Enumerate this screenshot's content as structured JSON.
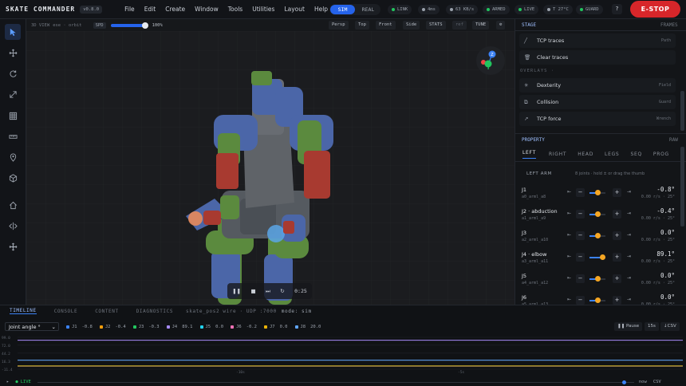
{
  "topbar": {
    "brand": "SKATE COMMANDER",
    "version": "v0.8.0",
    "menu": [
      "File",
      "Edit",
      "Create",
      "Window",
      "Tools",
      "Utilities",
      "Layout",
      "Help"
    ],
    "mode_sim": "SIM",
    "mode_real": "REAL",
    "link": "LINK",
    "latency": "4ms",
    "bandwidth": "63 KB/s",
    "armed": "ARMED",
    "live": "LIVE",
    "temp": "T 27°C",
    "guard": "GUARD",
    "help": "?",
    "estop": "E-STOP"
  },
  "viewport": {
    "view_label": "3D VIEW",
    "hint": "ese · orbit",
    "spd_label": "SPD",
    "spd_value": "100%",
    "speed_fraction": 1.0,
    "buttons": [
      "Persp",
      "Top",
      "Front",
      "Side",
      "STATS",
      "ref",
      "TUNE"
    ],
    "gizmo": {
      "z": "Z",
      "x": "X",
      "y": "Y"
    },
    "time": "0:25"
  },
  "right": {
    "stage_tab": "STAGE",
    "frames_tab": "FRAMES",
    "stage_rows": [
      {
        "label": "TCP traces",
        "tag": "Path"
      },
      {
        "label": "Clear traces",
        "tag": ""
      }
    ],
    "overlays_label": "OVERLAYS ·",
    "overlay_rows": [
      {
        "label": "Dexterity",
        "tag": "Field"
      },
      {
        "label": "Collision",
        "tag": "Guard"
      },
      {
        "label": "TCP force",
        "tag": "Wrench"
      }
    ],
    "property_tab": "PROPERTY",
    "raw_tab": "RAW",
    "arm_tabs": [
      "LEFT",
      "RIGHT",
      "HEAD",
      "LEGS",
      "SEQ",
      "PROG"
    ],
    "arm_title": "LEFT ARM",
    "arm_hint": "8 joints · hold ± or drag the thumb",
    "joints": [
      {
        "name": "J1",
        "sub": "a0_arml_a8",
        "value": "-0.8°",
        "rate": "0.00 r/s · 25°",
        "frac": 0.48
      },
      {
        "name": "J2 · abduction",
        "sub": "a1_arml_a9",
        "value": "-0.4°",
        "rate": "0.00 r/s · 25°",
        "frac": 0.49
      },
      {
        "name": "J3",
        "sub": "a2_arml_a10",
        "value": "0.0°",
        "rate": "0.00 r/s · 25°",
        "frac": 0.5
      },
      {
        "name": "J4 · elbow",
        "sub": "a3_arml_a11",
        "value": "89.1°",
        "rate": "0.00 r/s · 25°",
        "frac": 0.8
      },
      {
        "name": "J5",
        "sub": "a4_arml_a12",
        "value": "0.0°",
        "rate": "0.00 r/s · 25°",
        "frac": 0.5
      },
      {
        "name": "J6",
        "sub": "a5_arml_a13",
        "value": "0.0°",
        "rate": "0.00 r/s · 25°",
        "frac": 0.5
      }
    ]
  },
  "timeline": {
    "tabs": [
      "TIMELINE",
      "CONSOLE",
      "CONTENT",
      "DIAGNOSTICS"
    ],
    "info": "skate_pos2 wire · UDP :7000",
    "mode": "mode: sim",
    "select": "Joint angle °",
    "legend": [
      {
        "name": "J1",
        "val": "-0.8",
        "color": "#3b82f6"
      },
      {
        "name": "J2",
        "val": "-0.4",
        "color": "#f59e0b"
      },
      {
        "name": "J3",
        "val": "-0.3",
        "color": "#22c55e"
      },
      {
        "name": "J4",
        "val": "89.1",
        "color": "#a78bfa"
      },
      {
        "name": "J5",
        "val": "0.0",
        "color": "#22d3ee"
      },
      {
        "name": "J6",
        "val": "-0.2",
        "color": "#f472b6"
      },
      {
        "name": "J7",
        "val": "0.0",
        "color": "#eab308"
      },
      {
        "name": "J8",
        "val": "20.0",
        "color": "#60a5fa"
      }
    ],
    "pause": "Pause",
    "window": "15s",
    "csv": "CSV",
    "yticks": [
      "99.0",
      "72.0",
      "44.2",
      "16.3",
      "-11.4"
    ],
    "xticks": [
      "-10s",
      "-5s"
    ],
    "status_live": "LIVE",
    "status_now": "now",
    "status_csv": "CSV"
  },
  "chart_data": {
    "type": "line",
    "xlabel": "",
    "ylabel": "",
    "ylim": [
      -11.4,
      99.0
    ],
    "x": [
      -15,
      0
    ],
    "series": [
      {
        "name": "J1",
        "values": [
          -0.8,
          -0.8
        ]
      },
      {
        "name": "J2",
        "values": [
          -0.4,
          -0.4
        ]
      },
      {
        "name": "J3",
        "values": [
          -0.3,
          -0.3
        ]
      },
      {
        "name": "J4",
        "values": [
          89.1,
          89.1
        ]
      },
      {
        "name": "J5",
        "values": [
          0.0,
          0.0
        ]
      },
      {
        "name": "J6",
        "values": [
          -0.2,
          -0.2
        ]
      },
      {
        "name": "J7",
        "values": [
          0.0,
          0.0
        ]
      },
      {
        "name": "J8",
        "values": [
          20.0,
          20.0
        ]
      }
    ]
  }
}
